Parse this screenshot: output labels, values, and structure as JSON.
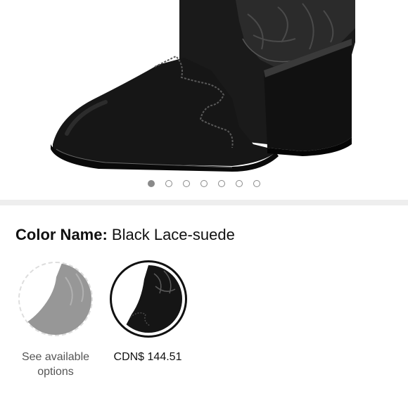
{
  "product": {
    "image_alt": "black suede and lace western ankle boot",
    "carousel": {
      "count": 7,
      "active_index": 0
    }
  },
  "variation": {
    "label": "Color Name:",
    "value": "Black Lace-suede"
  },
  "swatches": [
    {
      "name": "unavailable-variant",
      "caption_line1": "See available",
      "caption_line2": "options",
      "selected": false
    },
    {
      "name": "black-lace-suede",
      "price": "CDN$ 144.51",
      "selected": true
    }
  ],
  "colors": {
    "boot": "#151515",
    "lace": "#2b2b2b",
    "dot": "#8a8a8a",
    "divider": "#eeeeee",
    "selected_border": "#111111"
  }
}
